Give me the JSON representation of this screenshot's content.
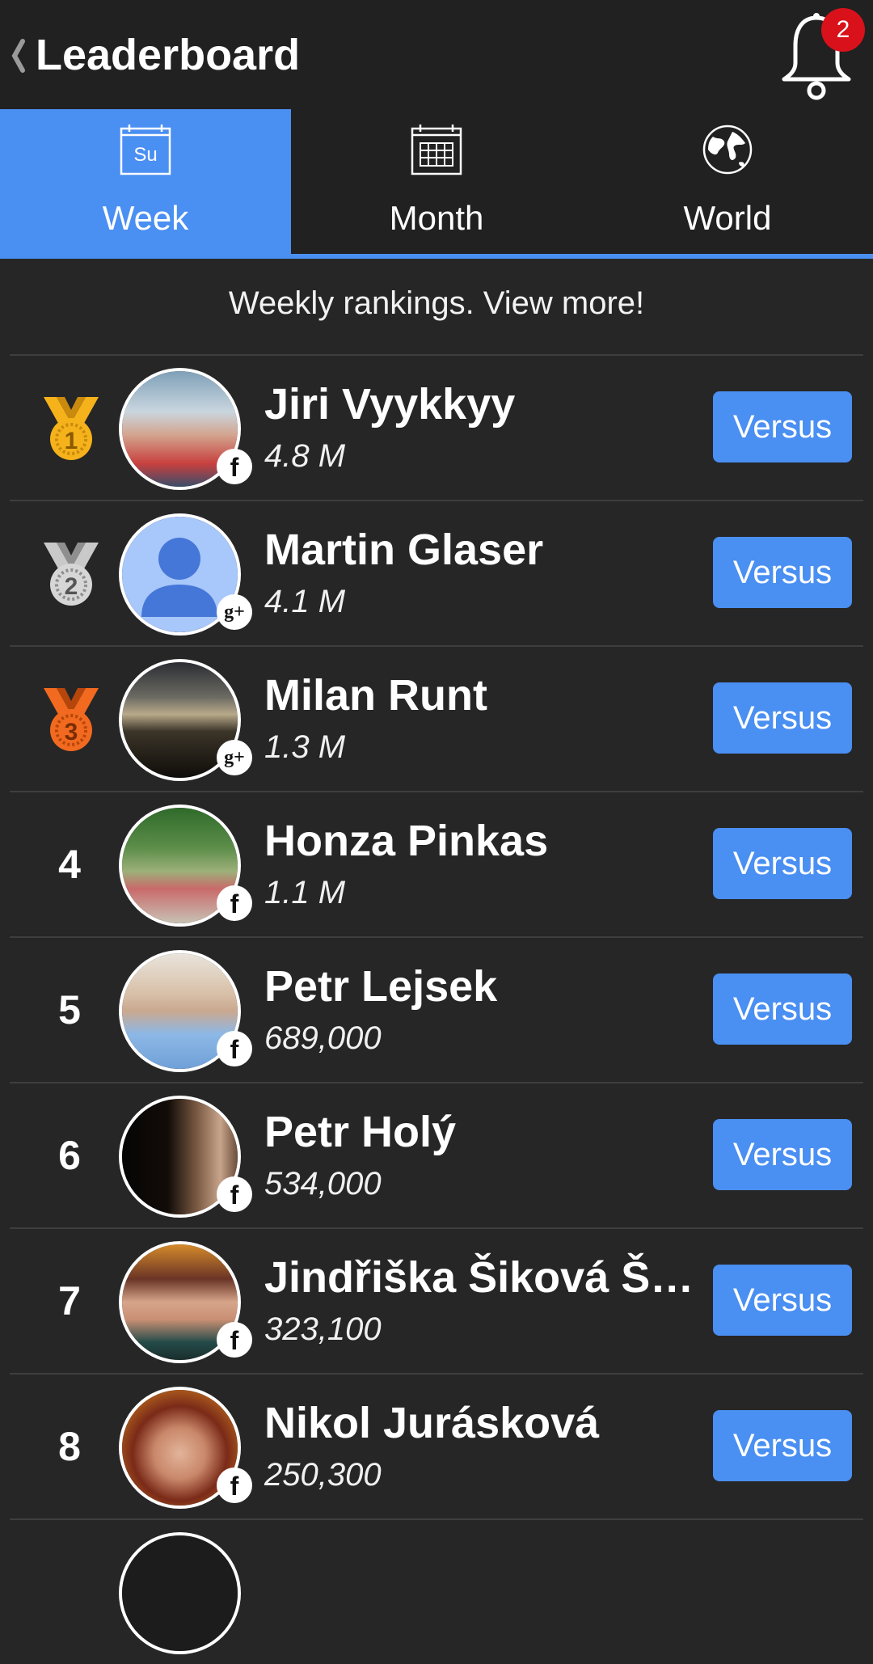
{
  "header": {
    "title": "Leaderboard",
    "notification_count": "2"
  },
  "tabs": [
    {
      "label": "Week",
      "icon": "weekly-calendar-icon",
      "icon_text": "Su",
      "active": true
    },
    {
      "label": "Month",
      "icon": "monthly-calendar-icon",
      "active": false
    },
    {
      "label": "World",
      "icon": "globe-icon",
      "active": false
    }
  ],
  "notice": "Weekly rankings. View more!",
  "colors": {
    "accent": "#4a8ff2",
    "background": "#262626",
    "bar": "#212121",
    "badge": "#d8111b",
    "gold": "#f5b21b",
    "silver": "#c9c9c9",
    "bronze": "#f26a1f"
  },
  "players": [
    {
      "rank": "1",
      "medal": "gold",
      "name": "Jiri Vyykkyy",
      "score": "4.8 M",
      "network": "facebook",
      "network_label": "f",
      "action": "Versus"
    },
    {
      "rank": "2",
      "medal": "silver",
      "name": "Martin Glaser",
      "score": "4.1 M",
      "network": "google-plus",
      "network_label": "g+",
      "action": "Versus"
    },
    {
      "rank": "3",
      "medal": "bronze",
      "name": "Milan Runt",
      "score": "1.3 M",
      "network": "google-plus",
      "network_label": "g+",
      "action": "Versus"
    },
    {
      "rank": "4",
      "name": "Honza Pinkas",
      "score": "1.1 M",
      "network": "facebook",
      "network_label": "f",
      "action": "Versus"
    },
    {
      "rank": "5",
      "name": "Petr Lejsek",
      "score": "689,000",
      "network": "facebook",
      "network_label": "f",
      "action": "Versus"
    },
    {
      "rank": "6",
      "name": "Petr Holý",
      "score": "534,000",
      "network": "facebook",
      "network_label": "f",
      "action": "Versus"
    },
    {
      "rank": "7",
      "name": "Jindřiška Šiková Šty...",
      "score": "323,100",
      "network": "facebook",
      "network_label": "f",
      "action": "Versus"
    },
    {
      "rank": "8",
      "name": "Nikol Jurásková",
      "score": "250,300",
      "network": "facebook",
      "network_label": "f",
      "action": "Versus"
    }
  ]
}
